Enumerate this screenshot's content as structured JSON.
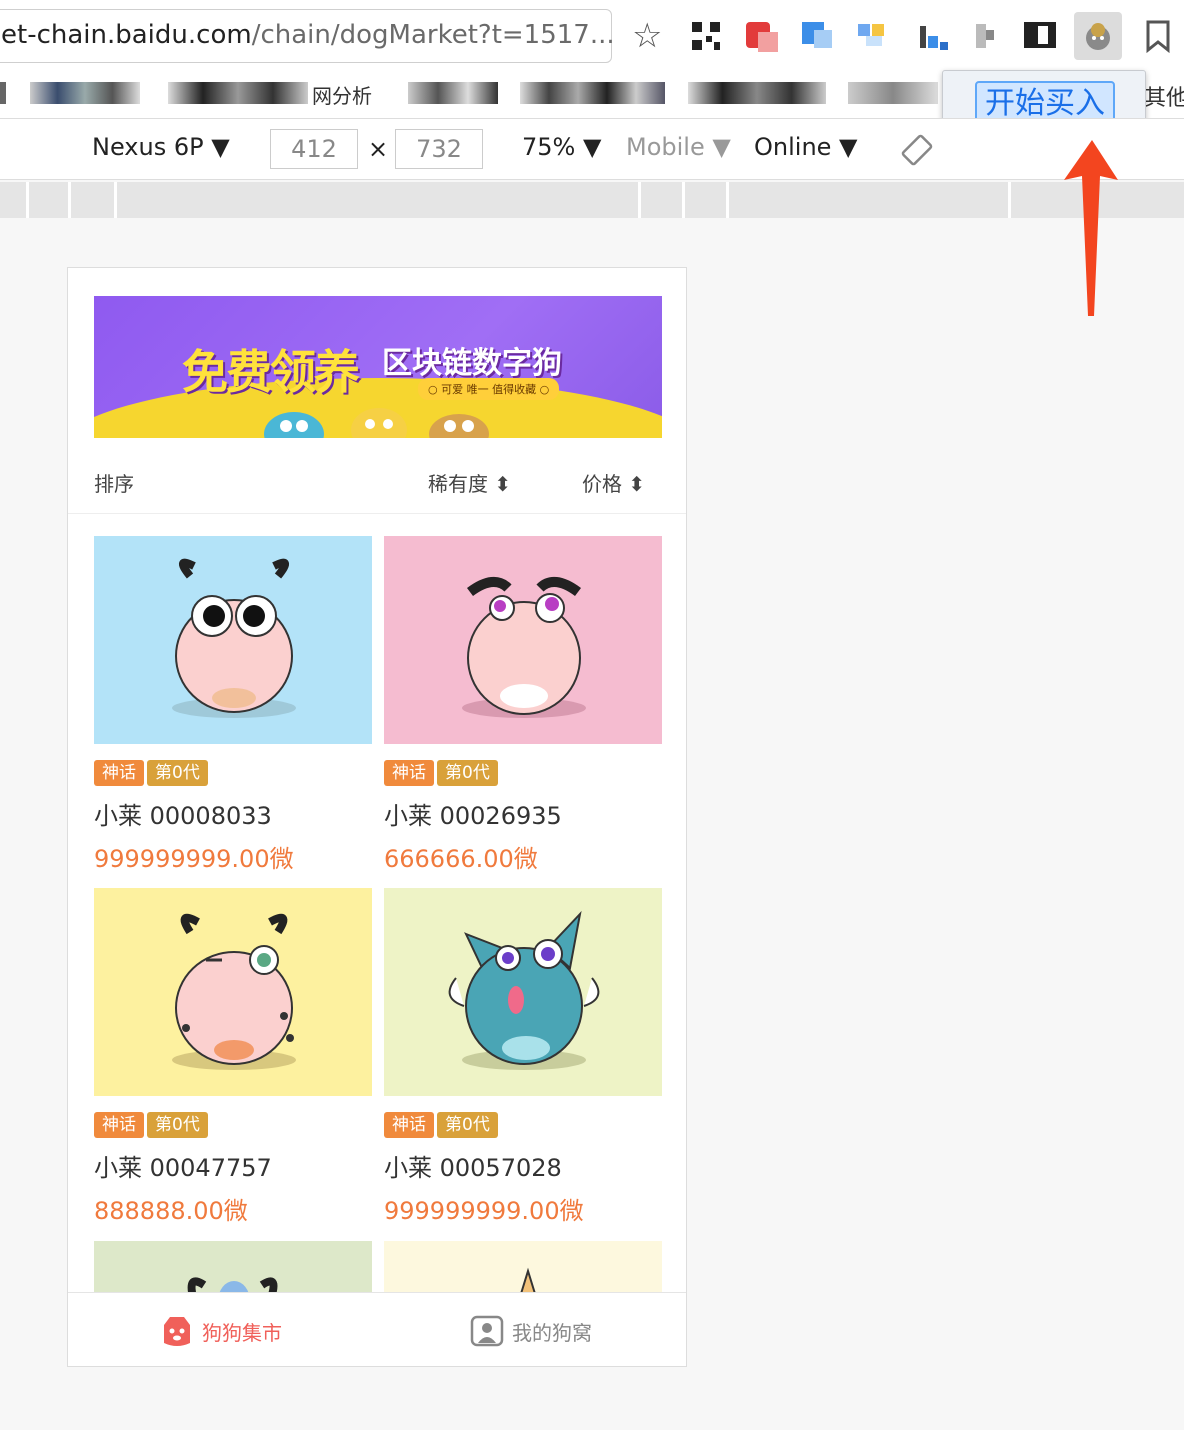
{
  "browser": {
    "url_main": "et-chain.baidu.com",
    "url_rest": "/chain/dogMarket?t=1517...",
    "bookmark_text_1": "网分析",
    "bookmark_text_2": "其他"
  },
  "popup": {
    "buy_label": "开始买入"
  },
  "devtools": {
    "device": "Nexus 6P ▼",
    "width": "412",
    "times": "×",
    "height": "732",
    "zoom": "75% ▼",
    "network": "Mobile ▼",
    "online": "Online ▼"
  },
  "banner": {
    "title": "免费领养",
    "subtitle_title": "区块链数字狗",
    "tagline": "○ 可爱  唯一  值得收藏 ○"
  },
  "sort": {
    "label": "排序",
    "rarity": "稀有度 ⬍",
    "price": "价格 ⬍"
  },
  "dogs": [
    {
      "tag1": "神话",
      "tag2": "第0代",
      "name": "小莱 00008033",
      "price": "999999999.00微",
      "bg": "#b3e3f8"
    },
    {
      "tag1": "神话",
      "tag2": "第0代",
      "name": "小莱 00026935",
      "price": "666666.00微",
      "bg": "#f5bcd0"
    },
    {
      "tag1": "神话",
      "tag2": "第0代",
      "name": "小莱 00047757",
      "price": "888888.00微",
      "bg": "#fdf19f"
    },
    {
      "tag1": "神话",
      "tag2": "第0代",
      "name": "小莱 00057028",
      "price": "999999999.00微",
      "bg": "#eef3c6"
    }
  ],
  "tabs": {
    "market": "狗狗集市",
    "mine": "我的狗窝"
  },
  "colors": {
    "accent": "#f07a3d",
    "tab_active": "#f0605a",
    "arrow": "#f3451f"
  }
}
